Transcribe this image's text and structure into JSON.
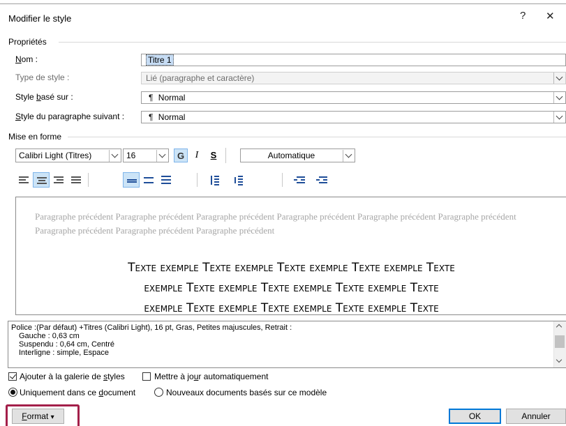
{
  "dialog": {
    "title": "Modifier le style",
    "help_glyph": "?",
    "close_glyph": "✕"
  },
  "properties": {
    "section_label": "Propriétés",
    "name": {
      "label_pre": "",
      "label_u": "N",
      "label_post": "om :",
      "value": "Titre 1"
    },
    "style_type": {
      "label": "Type de style :",
      "value": "Lié (paragraphe et caractère)"
    },
    "based_on": {
      "label_pre": "Style ",
      "label_u": "b",
      "label_post": "asé sur :",
      "value": "Normal",
      "glyph": "¶"
    },
    "next_style": {
      "label_pre": "",
      "label_u": "S",
      "label_post": "tyle du paragraphe suivant :",
      "value": "Normal",
      "glyph": "¶"
    }
  },
  "formatting": {
    "section_label": "Mise en forme",
    "font": "Calibri Light (Titres)",
    "size": "16",
    "bold": "G",
    "italic": "I",
    "underline": "S",
    "color": "Automatique"
  },
  "preview": {
    "previous_paragraph": "Paragraphe précédent Paragraphe précédent Paragraphe précédent Paragraphe précédent Paragraphe précédent Paragraphe précédent Paragraphe précédent Paragraphe précédent Paragraphe précédent",
    "sample_lines": [
      "Texte exemple Texte exemple Texte exemple Texte exemple Texte",
      "exemple Texte exemple Texte exemple Texte exemple Texte",
      "exemple Texte exemple Texte exemple Texte exemple Texte"
    ]
  },
  "description": {
    "lines": [
      "Police :(Par défaut) +Titres (Calibri Light), 16 pt, Gras, Petites majuscules, Retrait :",
      "Gauche :  0,63 cm",
      "Suspendu : 0,64 cm, Centré",
      "Interligne : simple, Espace"
    ]
  },
  "options": {
    "add_gallery": {
      "pre": "Ajouter à la galerie de ",
      "u": "s",
      "post": "tyles",
      "checked": true
    },
    "auto_update": {
      "pre": "Mettre à jo",
      "u": "u",
      "post": "r automatiquement",
      "checked": false
    },
    "only_doc": {
      "pre": "Uniquement dans ce ",
      "u": "d",
      "post": "ocument",
      "selected": true
    },
    "new_docs": {
      "label": "Nouveaux documents basés sur ce modèle",
      "selected": false
    }
  },
  "buttons": {
    "format": {
      "u": "F",
      "post": "ormat",
      "arrow": "▾"
    },
    "ok": "OK",
    "cancel": "Annuler"
  },
  "colors": {
    "highlight_border": "#a31f4a",
    "selection": "#c6dcf4",
    "default_button": "#0078d7"
  }
}
